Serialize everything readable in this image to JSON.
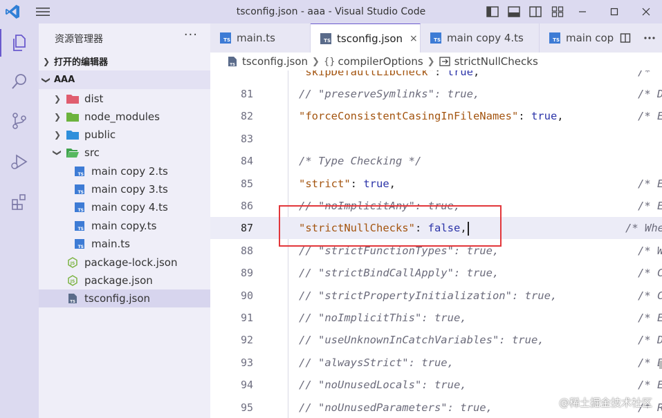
{
  "window": {
    "title": "tsconfig.json - aaa - Visual Studio Code",
    "controls": [
      "minimize-icon",
      "maximize-icon",
      "close-icon"
    ]
  },
  "explorer": {
    "title": "资源管理器",
    "more": "···",
    "open_editors": "打开的编辑器",
    "project": "AAA",
    "tree": [
      {
        "label": "dist",
        "type": "folder",
        "icon": "folder-dist-icon",
        "color": "#e05d6f"
      },
      {
        "label": "node_modules",
        "type": "folder",
        "icon": "folder-node-icon",
        "color": "#6cb33e"
      },
      {
        "label": "public",
        "type": "folder",
        "icon": "folder-public-icon",
        "color": "#2f8fdb"
      },
      {
        "label": "src",
        "type": "folder-open",
        "icon": "folder-src-icon",
        "color": "#3fa34d"
      },
      {
        "label": "main copy 2.ts",
        "type": "ts",
        "icon": "ts-file-icon"
      },
      {
        "label": "main copy 3.ts",
        "type": "ts",
        "icon": "ts-file-icon"
      },
      {
        "label": "main copy 4.ts",
        "type": "ts",
        "icon": "ts-file-icon"
      },
      {
        "label": "main copy.ts",
        "type": "ts",
        "icon": "ts-file-icon"
      },
      {
        "label": "main.ts",
        "type": "ts",
        "icon": "ts-file-icon"
      },
      {
        "label": "package-lock.json",
        "type": "json",
        "icon": "node-json-icon"
      },
      {
        "label": "package.json",
        "type": "json",
        "icon": "node-json-icon"
      },
      {
        "label": "tsconfig.json",
        "type": "tsconfig",
        "icon": "tsconfig-icon",
        "selected": true
      }
    ]
  },
  "tabs": [
    {
      "label": "main.ts",
      "active": false
    },
    {
      "label": "tsconfig.json",
      "active": true,
      "close": "×"
    },
    {
      "label": "main copy 4.ts",
      "active": false
    },
    {
      "label": "main cop",
      "active": false
    }
  ],
  "breadcrumb": {
    "file": "tsconfig.json",
    "obj_symbol": "{}",
    "obj": "compilerOptions",
    "prop": "strictNullChecks"
  },
  "code_lines": [
    {
      "num": "",
      "text": "\"skipDefaultLibCheck\": true,",
      "comment": "/* ",
      "partial_top": true
    },
    {
      "num": "81",
      "text": "// \"preserveSymlinks\": true,",
      "comment": "/* D"
    },
    {
      "num": "82",
      "text": "\"forceConsistentCasingInFileNames\": true,",
      "comment": "/* E"
    },
    {
      "num": "83",
      "text": "",
      "comment": ""
    },
    {
      "num": "84",
      "text": "/* Type Checking */",
      "comment": ""
    },
    {
      "num": "85",
      "text": "\"strict\": true,",
      "comment": "/* E"
    },
    {
      "num": "86",
      "text": "// \"noImplicitAny\": true,",
      "comment": "/* E"
    },
    {
      "num": "87",
      "text": "\"strictNullChecks\": false,",
      "comment": "/* Whe",
      "current": true
    },
    {
      "num": "88",
      "text": "// \"strictFunctionTypes\": true,",
      "comment": "/* W"
    },
    {
      "num": "89",
      "text": "// \"strictBindCallApply\": true,",
      "comment": "/* C"
    },
    {
      "num": "90",
      "text": "// \"strictPropertyInitialization\": true,",
      "comment": "/* C"
    },
    {
      "num": "91",
      "text": "// \"noImplicitThis\": true,",
      "comment": "/* E"
    },
    {
      "num": "92",
      "text": "// \"useUnknownInCatchVariables\": true,",
      "comment": "/* D"
    },
    {
      "num": "93",
      "text": "// \"alwaysStrict\": true,",
      "comment": "/* E"
    },
    {
      "num": "94",
      "text": "// \"noUnusedLocals\": true,",
      "comment": "/* E"
    },
    {
      "num": "95",
      "text": "// \"noUnusedParameters\": true,",
      "comment": "/* R"
    }
  ],
  "watermark": "@稀土掘金技术社区",
  "colors": {
    "accent": "#6a5acd",
    "highlight_box": "#e2363a",
    "key": "#a3540f",
    "bool": "#2b33a8"
  }
}
